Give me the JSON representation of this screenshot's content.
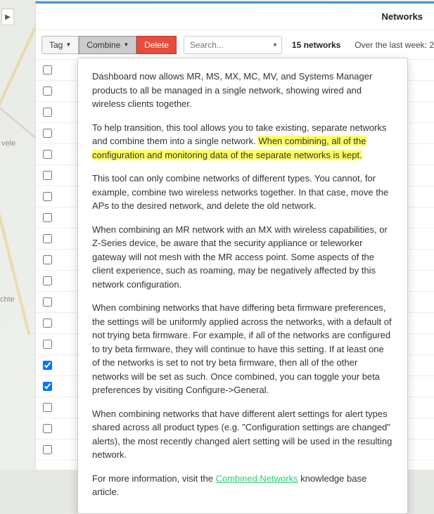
{
  "header": {
    "title": "Networks"
  },
  "toolbar": {
    "tag_label": "Tag",
    "combine_label": "Combine",
    "delete_label": "Delete",
    "search_placeholder": "Search...",
    "count_label": "15 networks",
    "timerange_label": "Over the last week: 2"
  },
  "rows": {
    "items": [
      {
        "checked": false
      },
      {
        "checked": false
      },
      {
        "checked": false
      },
      {
        "checked": false
      },
      {
        "checked": false
      },
      {
        "checked": false
      },
      {
        "checked": false
      },
      {
        "checked": false
      },
      {
        "checked": false
      },
      {
        "checked": false
      },
      {
        "checked": false
      },
      {
        "checked": false
      },
      {
        "checked": false
      },
      {
        "checked": false
      },
      {
        "checked": true
      },
      {
        "checked": true
      },
      {
        "checked": false
      },
      {
        "checked": false
      },
      {
        "checked": false
      }
    ]
  },
  "dropdown": {
    "p1": "Dashboard now allows MR, MS, MX, MC, MV, and Systems Manager products to all be managed in a single network, showing wired and wireless clients together.",
    "p2_pre": "To help transition, this tool allows you to take existing, separate networks and combine them into a single network. ",
    "p2_hl": "When combining, all of the configuration and monitoring data of the separate networks is kept.",
    "p3": "This tool can only combine networks of different types. You cannot, for example, combine two wireless networks together. In that case, move the APs to the desired network, and delete the old network.",
    "p4": "When combining an MR network with an MX with wireless capabilities, or Z-Series device, be aware that the security appliance or teleworker gateway will not mesh with the MR access point. Some aspects of the client experience, such as roaming, may be negatively affected by this network configuration.",
    "p5": "When combining networks that have differing beta firmware preferences, the settings will be uniformly applied across the networks, with a default of not trying beta firmware. For example, if all of the networks are configured to try beta firmware, they will continue to have this setting. If at least one of the networks is set to not try beta firmware, then all of the other networks will be set as such. Once combined, you can toggle your beta preferences by visiting Configure->General.",
    "p6": "When combining networks that have different alert settings for alert types shared across all product types (e.g. \"Configuration settings are changed\" alerts), the most recently changed alert setting will be used in the resulting network.",
    "p7_pre": "For more information, visit the ",
    "p7_link": "Combined Networks",
    "p7_post": " knowledge base article."
  },
  "map": {
    "label1": "vele",
    "label2": "chte"
  }
}
